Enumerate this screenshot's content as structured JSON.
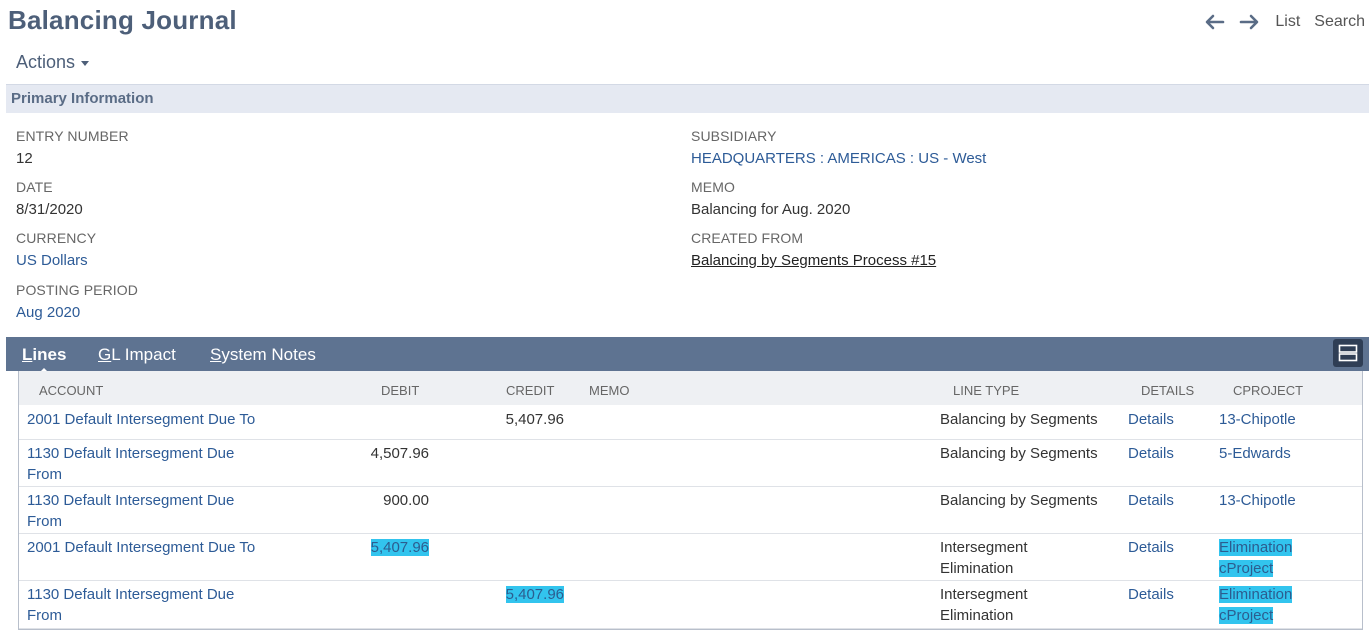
{
  "title": "Balancing Journal",
  "nav": {
    "back_icon": "arrow-left-icon",
    "forward_icon": "arrow-right-icon",
    "list": "List",
    "search": "Search"
  },
  "actions": "Actions",
  "section": "Primary Information",
  "fields": {
    "entry_number": {
      "label": "ENTRY NUMBER",
      "value": "12"
    },
    "date": {
      "label": "DATE",
      "value": "8/31/2020"
    },
    "currency": {
      "label": "CURRENCY",
      "value": "US Dollars"
    },
    "posting_period": {
      "label": "POSTING PERIOD",
      "value": "Aug 2020"
    },
    "subsidiary": {
      "label": "SUBSIDIARY",
      "value": "HEADQUARTERS : AMERICAS : US - West"
    },
    "memo": {
      "label": "MEMO",
      "value": "Balancing for Aug. 2020"
    },
    "created_from": {
      "label": "CREATED FROM",
      "value": "Balancing by Segments Process #15"
    }
  },
  "tabs": [
    {
      "label": "Lines",
      "hotkey": "L",
      "rest": "ines"
    },
    {
      "label": "GL Impact",
      "hotkey": "G",
      "rest": "L Impact"
    },
    {
      "label": "System Notes",
      "hotkey": "S",
      "rest": "ystem Notes"
    }
  ],
  "columns": {
    "account": "ACCOUNT",
    "debit": "DEBIT",
    "credit": "CREDIT",
    "memo": "MEMO",
    "line_type": "LINE TYPE",
    "details": "DETAILS",
    "cproject": "CPROJECT"
  },
  "rows": [
    {
      "account": [
        "2001 Default Intersegment Due To"
      ],
      "debit": "",
      "credit": "5,407.96",
      "line_type": [
        "Balancing by Segments"
      ],
      "details": "Details",
      "cproject": [
        "13-Chipotle"
      ]
    },
    {
      "account": [
        "1130 Default Intersegment Due",
        "From"
      ],
      "debit": "4,507.96",
      "credit": "",
      "line_type": [
        "Balancing by Segments"
      ],
      "details": "Details",
      "cproject": [
        "5-Edwards"
      ]
    },
    {
      "account": [
        "1130 Default Intersegment Due",
        "From"
      ],
      "debit": "900.00",
      "credit": "",
      "line_type": [
        "Balancing by Segments"
      ],
      "details": "Details",
      "cproject": [
        "13-Chipotle"
      ]
    },
    {
      "account": [
        "2001 Default Intersegment Due To"
      ],
      "debit": "5,407.96",
      "credit": "",
      "line_type": [
        "Intersegment",
        "Elimination"
      ],
      "details": "Details",
      "cproject": [
        "Elimination",
        "cProject"
      ]
    },
    {
      "account": [
        "1130 Default Intersegment Due",
        "From"
      ],
      "debit": "",
      "credit": "5,407.96",
      "line_type": [
        "Intersegment",
        "Elimination"
      ],
      "details": "Details",
      "cproject": [
        "Elimination",
        "cProject"
      ]
    }
  ],
  "colors": {
    "title": "#4d5f79",
    "link": "#2d5b97",
    "tabbar": "#5e7391",
    "highlight": "#32c4ee"
  }
}
